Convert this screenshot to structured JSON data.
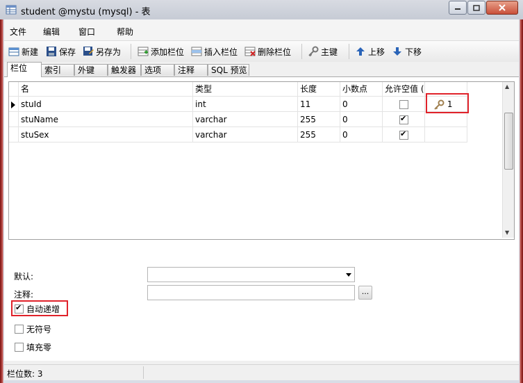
{
  "window": {
    "title": "student @mystu (mysql) - 表"
  },
  "menu": [
    "文件",
    "编辑",
    "窗口",
    "帮助"
  ],
  "toolbar": {
    "new": "新建",
    "save": "保存",
    "save_as": "另存为",
    "add_field": "添加栏位",
    "insert_field": "插入栏位",
    "delete_field": "删除栏位",
    "primary_key": "主键",
    "move_up": "上移",
    "move_down": "下移"
  },
  "tabs": [
    "栏位",
    "索引",
    "外键",
    "触发器",
    "选项",
    "注释",
    "SQL 预览"
  ],
  "grid": {
    "headers": [
      "名",
      "类型",
      "长度",
      "小数点",
      "允许空值 (",
      ""
    ],
    "rows": [
      {
        "name": "stuId",
        "type": "int",
        "length": "11",
        "decimals": "0",
        "allow_null": false,
        "key": "1"
      },
      {
        "name": "stuName",
        "type": "varchar",
        "length": "255",
        "decimals": "0",
        "allow_null": true,
        "key": ""
      },
      {
        "name": "stuSex",
        "type": "varchar",
        "length": "255",
        "decimals": "0",
        "allow_null": true,
        "key": ""
      }
    ]
  },
  "props": {
    "default_label": "默认:",
    "comment_label": "注释:",
    "browse": "...",
    "auto_increment": "自动递增",
    "unsigned": "无符号",
    "zerofill": "填充零"
  },
  "status": {
    "field_count": "栏位数: 3"
  },
  "colors": {
    "highlight_box": "#e0222a"
  }
}
